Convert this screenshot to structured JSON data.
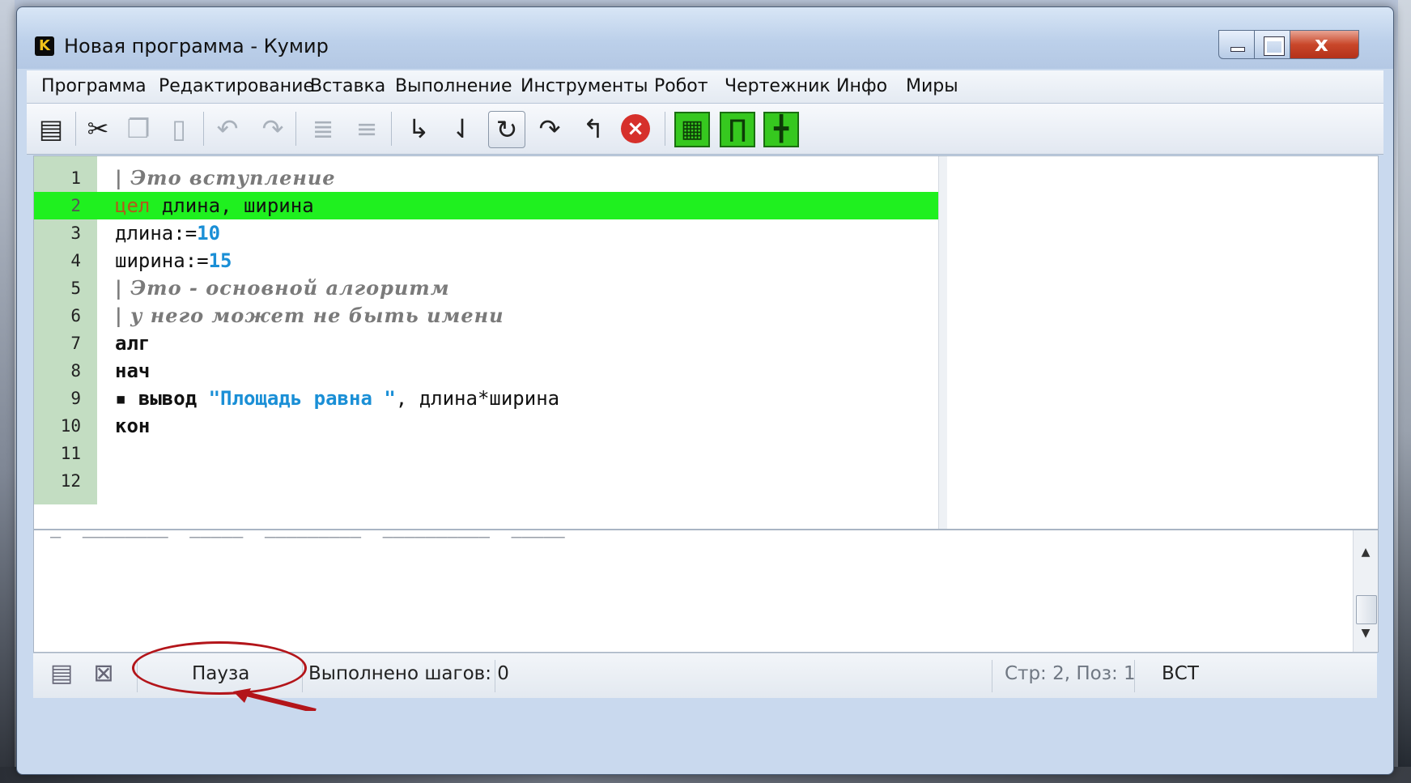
{
  "window": {
    "title": "Новая программа - Кумир",
    "app_icon_letter": "K"
  },
  "menu": [
    "Программа",
    "Редактирование",
    "Вставка",
    "Выполнение",
    "Инструменты",
    "Робот",
    "Чертежник",
    "Инфо",
    "Миры"
  ],
  "toolbar": {
    "icons": [
      "save-icon",
      "cut-icon",
      "copy-icon",
      "paste-icon",
      "undo-icon",
      "redo-icon",
      "indent-icon",
      "unindent-icon",
      "run-icon",
      "step-into-icon",
      "step-over-icon",
      "step-next-icon",
      "step-out-icon",
      "stop-icon",
      "robot-field-icon",
      "painter-icon",
      "grid-icon"
    ]
  },
  "editor": {
    "current_line": 2,
    "lines": [
      {
        "num": "1",
        "parts": [
          {
            "t": "| Это вступление",
            "c": "comment"
          }
        ]
      },
      {
        "num": "2",
        "parts": [
          {
            "t": "цел",
            "c": "type"
          },
          {
            "t": " длина, ширина",
            "c": ""
          }
        ]
      },
      {
        "num": "3",
        "parts": [
          {
            "t": "длина:=",
            "c": ""
          },
          {
            "t": "10",
            "c": "num"
          }
        ]
      },
      {
        "num": "4",
        "parts": [
          {
            "t": "ширина:=",
            "c": ""
          },
          {
            "t": "15",
            "c": "num"
          }
        ]
      },
      {
        "num": "5",
        "parts": [
          {
            "t": "| Это - основной алгоритм",
            "c": "comment"
          }
        ]
      },
      {
        "num": "6",
        "parts": [
          {
            "t": "| у него может не быть имени",
            "c": "comment"
          }
        ]
      },
      {
        "num": "7",
        "parts": [
          {
            "t": "алг",
            "c": "kw"
          }
        ]
      },
      {
        "num": "8",
        "parts": [
          {
            "t": "нач",
            "c": "kw"
          }
        ]
      },
      {
        "num": "9",
        "parts": [
          {
            "t": "▪ ",
            "c": "kw"
          },
          {
            "t": "вывод",
            "c": "kw"
          },
          {
            "t": " ",
            "c": ""
          },
          {
            "t": "\"Площадь равна \"",
            "c": "str"
          },
          {
            "t": ", длина*ширина",
            "c": ""
          }
        ]
      },
      {
        "num": "10",
        "parts": [
          {
            "t": "кон",
            "c": "kw"
          }
        ]
      },
      {
        "num": "11",
        "parts": []
      },
      {
        "num": "12",
        "parts": []
      }
    ]
  },
  "console": {
    "text": "–  ––––––––  –––––  –––––––––  ––––––––––  –––––"
  },
  "status": {
    "state": "Пауза",
    "steps": "Выполнено шагов: 0",
    "position": "Стр: 2, Поз: 1",
    "mode": "ВСТ"
  },
  "colors": {
    "current_line": "#1ff01f",
    "gutter": "#c3ddc2",
    "number": "#1a8fd6",
    "type_keyword": "#b4581a",
    "annotation": "#b3151a"
  }
}
